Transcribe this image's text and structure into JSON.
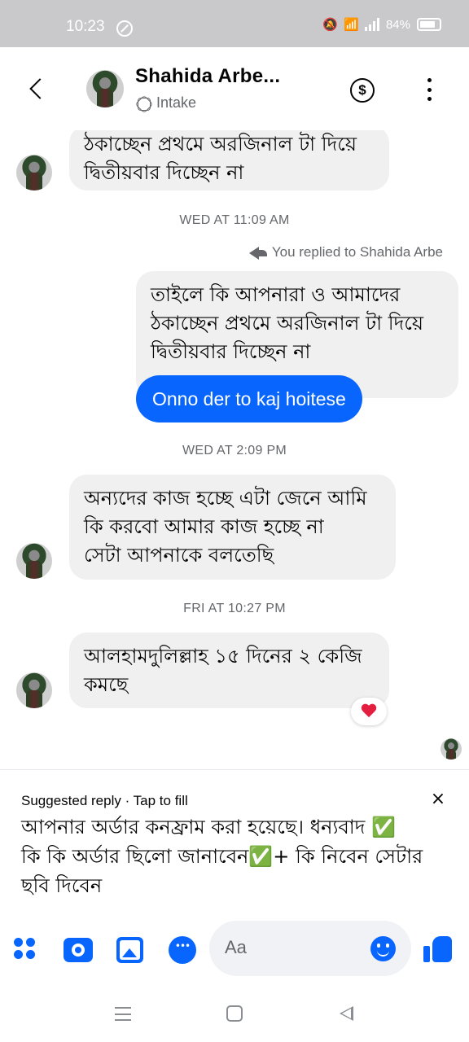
{
  "status_bar": {
    "time": "10:23",
    "battery": "84%",
    "battery_level": 0.84
  },
  "header": {
    "contact_name": "Shahida Arbe...",
    "subtitle": "Intake"
  },
  "conversation": {
    "msg1_text": "ঠকাচ্ছেন প্রথমে অরজিনাল টা দিয়ে\nদ্বিতীয়বার দিচ্ছেন না",
    "ts1": "WED AT 11:09 AM",
    "reply_note": "You replied to Shahida Arbe",
    "quoted_text": "তাইলে কি আপনারা ও আমাদের\nঠকাচ্ছেন প্রথমে অরজিনাল টা দিয়ে\nদ্বিতীয়বার দিচ্ছেন না",
    "sent_reply": "Onno der to kaj hoitese",
    "ts2": "WED AT 2:09 PM",
    "msg2_text": "অন্যদের কাজ হচ্ছে এটা জেনে আমি\nকি করবো আমার কাজ হচ্ছে না\nসেটা আপনাকে বলতেছি",
    "ts3": "FRI AT 10:27 PM",
    "msg3_text": "আলহামদুলিল্লাহ ১৫ দিনের ২ কেজি\nকমছে",
    "reaction": "heart"
  },
  "suggested_reply": {
    "label": "Suggested reply · Tap to fill",
    "close": "×",
    "text": "আপনার অর্ডার কনফ্রাম করা হয়েছে। ধন্যবাদ ✅\nকি কি অর্ডার ছিলো জানাবেন✅+ কি নিবেন সেটার\nছবি দিবেন"
  },
  "composer": {
    "placeholder": "Aa"
  },
  "colors": {
    "accent": "#0866ff",
    "bubble_gray": "#f0f0f0",
    "status_bar": "#c9c9cc",
    "reaction_heart": "#e41e3f"
  },
  "icons": [
    "back-icon",
    "dollar-icon",
    "more-icon",
    "intake-icon",
    "reply-icon",
    "heart-icon",
    "close-icon",
    "apps-icon",
    "camera-icon",
    "gallery-icon",
    "chat-icon",
    "emoji-icon",
    "like-icon"
  ]
}
